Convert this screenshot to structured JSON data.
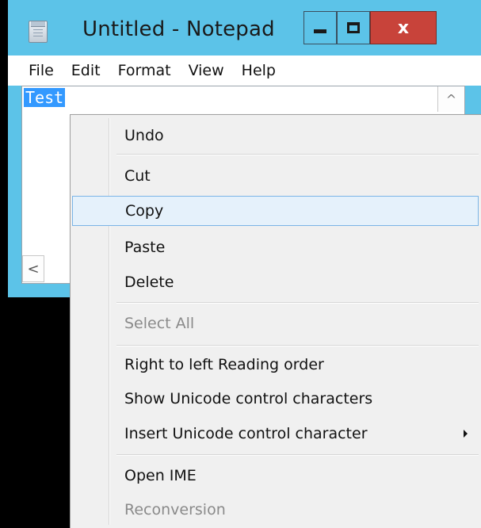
{
  "window": {
    "title": "Untitled - Notepad",
    "close_glyph": "x",
    "icon": "notepad-icon"
  },
  "menubar": {
    "items": [
      "File",
      "Edit",
      "Format",
      "View",
      "Help"
    ]
  },
  "editor": {
    "content": "Test",
    "selected": true,
    "selection_color": "#3399ff",
    "scroll_up_glyph": "^",
    "scroll_left_glyph": "<"
  },
  "context_menu": {
    "highlight_color": "#e5f1fb",
    "items": [
      {
        "label": "Undo",
        "enabled": true
      },
      {
        "label": "Cut",
        "enabled": true
      },
      {
        "label": "Copy",
        "enabled": true,
        "highlighted": true
      },
      {
        "label": "Paste",
        "enabled": true
      },
      {
        "label": "Delete",
        "enabled": true
      },
      {
        "label": "Select All",
        "enabled": false
      },
      {
        "label": "Right to left Reading order",
        "enabled": true
      },
      {
        "label": "Show Unicode control characters",
        "enabled": true
      },
      {
        "label": "Insert Unicode control character",
        "enabled": true,
        "submenu": true
      },
      {
        "label": "Open IME",
        "enabled": true
      },
      {
        "label": "Reconversion",
        "enabled": false
      }
    ]
  },
  "colors": {
    "titlebar": "#5cc3e8",
    "close_button": "#c8433a",
    "background": "#000000"
  }
}
